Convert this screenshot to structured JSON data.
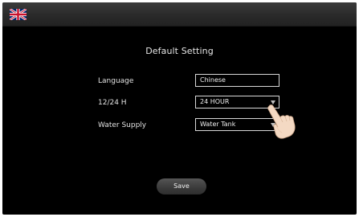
{
  "header": {
    "language_flag_icon": "uk-flag-icon"
  },
  "page": {
    "title": "Default Setting"
  },
  "settings": {
    "language": {
      "label": "Language",
      "value": "Chinese"
    },
    "time_format": {
      "label": "12/24 H",
      "value": "24 HOUR"
    },
    "water_supply": {
      "label": "Water Supply",
      "value": "Water Tank"
    }
  },
  "actions": {
    "save_label": "Save"
  },
  "colors": {
    "screen_bg": "#000000",
    "topbar_bg": "#2f2f2f",
    "field_border": "#d8d8d8",
    "button_bg": "#444444"
  }
}
